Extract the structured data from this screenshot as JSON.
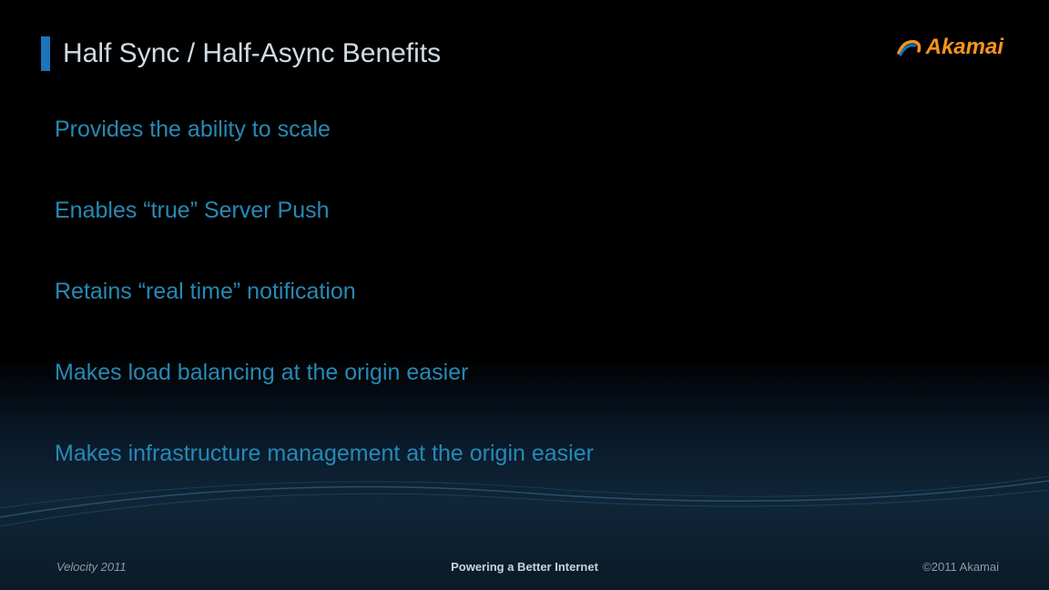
{
  "title": "Half Sync / Half-Async Benefits",
  "logo": {
    "brand": "Akamai"
  },
  "bullets": [
    "Provides the ability to scale",
    "Enables “true” Server Push",
    "Retains “real time” notification",
    "Makes load balancing at the origin easier",
    "Makes infrastructure management at the origin easier"
  ],
  "footer": {
    "left": "Velocity 2011",
    "center": "Powering a Better Internet",
    "right": "©2011 Akamai"
  },
  "colors": {
    "accent": "#1b75bc",
    "bullet": "#2789b5",
    "brand_orange": "#f7941d"
  }
}
